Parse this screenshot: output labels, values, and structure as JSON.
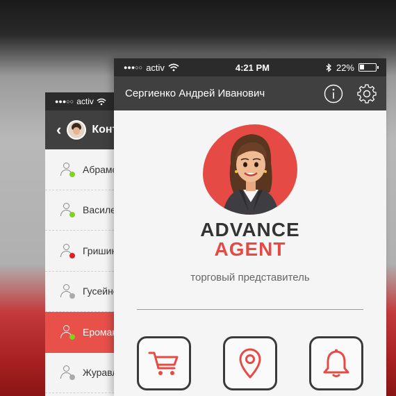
{
  "back_screen": {
    "status_bar": {
      "signal": "●●●○○",
      "carrier": "activ"
    },
    "header": {
      "title": "Конт"
    },
    "contacts": [
      {
        "name": "Абрамова",
        "status_color": "#7ed321"
      },
      {
        "name": "Василенко",
        "status_color": "#7ed321"
      },
      {
        "name": "Гришин",
        "status_color": "#e02020"
      },
      {
        "name": "Гусейнов",
        "status_color": "#aaaaaa"
      },
      {
        "name": "Еромаков",
        "status_color": "#7ed321",
        "selected": true
      },
      {
        "name": "Журавлев",
        "status_color": "#aaaaaa"
      }
    ]
  },
  "front_screen": {
    "status_bar": {
      "signal": "●●●○○",
      "carrier": "activ",
      "time": "4:21 PM",
      "battery": "22%"
    },
    "header": {
      "user_name": "Сергиенко Андрей Иванович"
    },
    "brand": {
      "line1": "ADVANCE",
      "line2": "AGENT",
      "subtitle": "торговый представитель"
    },
    "actions": [
      {
        "icon": "cart-icon"
      },
      {
        "icon": "location-pin-icon"
      },
      {
        "icon": "bell-icon"
      }
    ]
  },
  "colors": {
    "accent": "#e54b44",
    "header_bg": "#404040",
    "status_bg": "#2b2b2b"
  }
}
